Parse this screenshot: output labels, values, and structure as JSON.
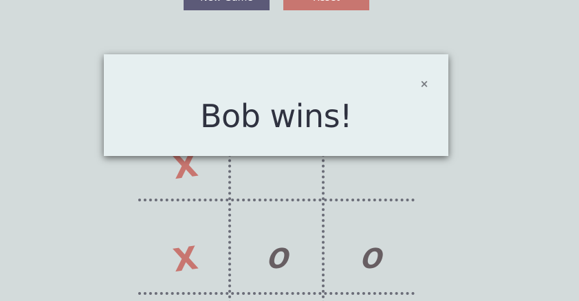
{
  "controls": {
    "new_game_label": "New Game",
    "reset_label": "Reset"
  },
  "board": {
    "cells": [
      {
        "row": 0,
        "col": 0,
        "mark": "X"
      },
      {
        "row": 0,
        "col": 1,
        "mark": ""
      },
      {
        "row": 0,
        "col": 2,
        "mark": ""
      },
      {
        "row": 1,
        "col": 0,
        "mark": "X"
      },
      {
        "row": 1,
        "col": 1,
        "mark": "O"
      },
      {
        "row": 1,
        "col": 2,
        "mark": "O"
      }
    ]
  },
  "modal": {
    "message": "Bob wins!",
    "close_icon": "×"
  },
  "colors": {
    "background": "#d3dbdb",
    "x_mark": "#c87670",
    "o_mark": "#675e62",
    "new_game_button": "#5c5a78",
    "reset_button": "#c87670",
    "modal_background": "#e6eff0"
  }
}
